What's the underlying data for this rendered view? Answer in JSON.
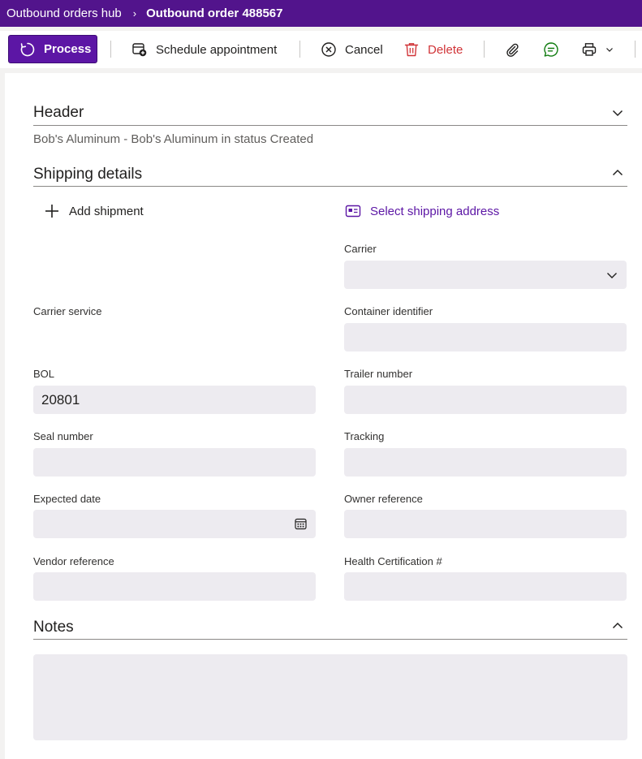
{
  "breadcrumb": {
    "parent": "Outbound orders hub",
    "current": "Outbound order 488567"
  },
  "toolbar": {
    "process_label": "Process",
    "schedule_label": "Schedule appointment",
    "cancel_label": "Cancel",
    "delete_label": "Delete"
  },
  "header_section": {
    "title": "Header",
    "description": "Bob's Aluminum - Bob's Aluminum in status Created"
  },
  "shipping_section": {
    "title": "Shipping details",
    "add_shipment_label": "Add shipment",
    "select_address_label": "Select shipping address",
    "fields": {
      "carrier": {
        "label": "Carrier",
        "value": ""
      },
      "carrier_service": {
        "label": "Carrier service"
      },
      "container_identifier": {
        "label": "Container identifier",
        "value": ""
      },
      "bol": {
        "label": "BOL",
        "value": "20801"
      },
      "trailer_number": {
        "label": "Trailer number",
        "value": ""
      },
      "seal_number": {
        "label": "Seal number",
        "value": ""
      },
      "tracking": {
        "label": "Tracking",
        "value": ""
      },
      "expected_date": {
        "label": "Expected date",
        "value": ""
      },
      "owner_reference": {
        "label": "Owner reference",
        "value": ""
      },
      "vendor_reference": {
        "label": "Vendor reference",
        "value": ""
      },
      "health_certification": {
        "label": "Health Certification #",
        "value": ""
      }
    }
  },
  "notes_section": {
    "title": "Notes",
    "value": ""
  },
  "colors": {
    "brand": "#52148c",
    "primary_button": "#5c16a5",
    "delete": "#d13438",
    "chat": "#107c10",
    "field_bg": "#edebf0",
    "link": "#5c16a5"
  },
  "icons": [
    "process-icon",
    "calendar-add-icon",
    "cancel-icon",
    "delete-icon",
    "attach-icon",
    "chat-icon",
    "print-icon",
    "chevron-down-icon",
    "chevron-up-icon",
    "add-icon",
    "address-card-icon",
    "calendar-icon"
  ]
}
